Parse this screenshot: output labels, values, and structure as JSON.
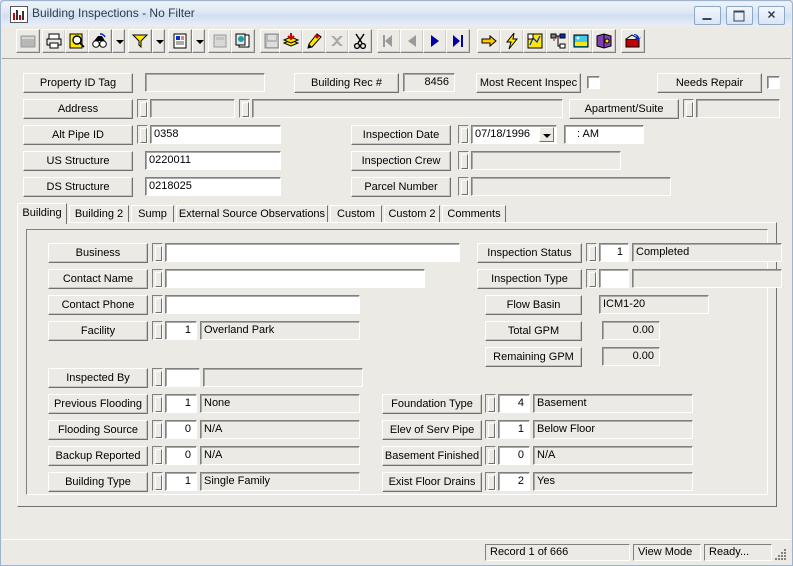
{
  "window": {
    "title": "Building Inspections - No Filter",
    "icon": "chart-bars-icon",
    "controls": {
      "minimize": "Minimize",
      "maximize": "Maximize",
      "close": "Close"
    }
  },
  "toolbar": {
    "buttons": [
      {
        "name": "grid-view-button",
        "icon": "grid-icon",
        "disabled": true
      },
      {
        "name": "print-button",
        "icon": "printer-icon",
        "disabled": false
      },
      {
        "name": "print-preview-button",
        "icon": "print-preview-icon",
        "disabled": false
      },
      {
        "name": "find-button",
        "icon": "binoculars-icon",
        "disabled": false
      },
      {
        "name": "find-dropdown-button",
        "icon": "chevron-down-icon",
        "disabled": false
      },
      {
        "name": "filter-button",
        "icon": "funnel-icon",
        "disabled": false
      },
      {
        "name": "filter-dropdown-button",
        "icon": "chevron-down-icon",
        "disabled": false
      },
      {
        "name": "report-button",
        "icon": "document-icon",
        "disabled": false
      },
      {
        "name": "report-dropdown-button",
        "icon": "chevron-down-icon",
        "disabled": false
      },
      {
        "name": "form-design-button",
        "icon": "form-icon",
        "disabled": true
      },
      {
        "name": "copy-record-button",
        "icon": "copy-pages-icon",
        "disabled": false
      },
      {
        "name": "save-button",
        "icon": "floppy-disk-icon",
        "disabled": true
      },
      {
        "name": "add-record-button",
        "icon": "add-stack-icon",
        "disabled": false
      },
      {
        "name": "edit-record-button",
        "icon": "pencil-icon",
        "disabled": false
      },
      {
        "name": "delete-record-button",
        "icon": "delete-x-icon",
        "disabled": true
      },
      {
        "name": "cut-button",
        "icon": "scissors-icon",
        "disabled": false
      },
      {
        "name": "first-record-button",
        "icon": "first-record-icon",
        "disabled": true
      },
      {
        "name": "previous-record-button",
        "icon": "previous-record-icon",
        "disabled": true
      },
      {
        "name": "next-record-button",
        "icon": "next-record-icon",
        "disabled": false
      },
      {
        "name": "last-record-button",
        "icon": "last-record-icon",
        "disabled": false
      },
      {
        "name": "goto-button",
        "icon": "yellow-arrow-icon",
        "disabled": false
      },
      {
        "name": "quick-action-button",
        "icon": "lightning-bolt-icon",
        "disabled": false
      },
      {
        "name": "map-button",
        "icon": "map-icon",
        "disabled": false
      },
      {
        "name": "hierarchy-button",
        "icon": "tree-nodes-icon",
        "disabled": false
      },
      {
        "name": "image-button",
        "icon": "picture-icon",
        "disabled": false
      },
      {
        "name": "help-book-button",
        "icon": "book-icon",
        "disabled": false
      },
      {
        "name": "exit-button",
        "icon": "exit-door-icon",
        "disabled": false
      }
    ]
  },
  "header": {
    "property_id_tag": {
      "label": "Property ID Tag",
      "value": ""
    },
    "building_rec": {
      "label": "Building Rec #",
      "value": "8456"
    },
    "most_recent_inspection": {
      "label": "Most Recent Inspec",
      "checked": false
    },
    "needs_repair": {
      "label": "Needs Repair",
      "checked": false
    },
    "address": {
      "label": "Address",
      "value1": "",
      "value2": ""
    },
    "apartment_suite": {
      "label": "Apartment/Suite",
      "value": ""
    },
    "alt_pipe_id": {
      "label": "Alt Pipe ID",
      "value": "0358"
    },
    "us_structure": {
      "label": "US Structure",
      "value": "0220011"
    },
    "ds_structure": {
      "label": "DS Structure",
      "value": "0218025"
    },
    "inspection_date": {
      "label": "Inspection Date",
      "value": "07/18/1996"
    },
    "inspection_time": {
      "value": ":   AM"
    },
    "inspection_crew": {
      "label": "Inspection Crew",
      "value": ""
    },
    "parcel_number": {
      "label": "Parcel Number",
      "value": ""
    }
  },
  "tabs": [
    {
      "label": "Building",
      "active": true
    },
    {
      "label": "Building 2",
      "active": false
    },
    {
      "label": "Sump",
      "active": false
    },
    {
      "label": "External Source Observations",
      "active": false
    },
    {
      "label": "Custom",
      "active": false
    },
    {
      "label": "Custom 2",
      "active": false
    },
    {
      "label": "Comments",
      "active": false
    }
  ],
  "building_tab": {
    "left_group": [
      {
        "label": "Business",
        "code": null,
        "desc": "",
        "desc_readonly": false
      },
      {
        "label": "Contact Name",
        "code": null,
        "desc": "",
        "desc_readonly": false
      },
      {
        "label": "Contact Phone",
        "code": null,
        "desc": "",
        "desc_readonly": false
      },
      {
        "label": "Facility",
        "code": "1",
        "desc": "Overland Park",
        "desc_readonly": true
      }
    ],
    "right_group": [
      {
        "label": "Inspection Status",
        "code": "1",
        "desc": "Completed"
      },
      {
        "label": "Inspection Type",
        "code": "",
        "desc": ""
      }
    ],
    "flow_basin": {
      "label": "Flow Basin",
      "value": "ICM1-20"
    },
    "total_gpm": {
      "label": "Total GPM",
      "value": "0.00"
    },
    "remaining_gpm": {
      "label": "Remaining GPM",
      "value": "0.00"
    },
    "lower_left": [
      {
        "label": "Inspected By",
        "code": "",
        "desc": "",
        "desc_readonly": true
      },
      {
        "label": "Previous Flooding",
        "code": "1",
        "desc": "None",
        "desc_readonly": true
      },
      {
        "label": "Flooding Source",
        "code": "0",
        "desc": "N/A",
        "desc_readonly": true
      },
      {
        "label": "Backup Reported",
        "code": "0",
        "desc": "N/A",
        "desc_readonly": true
      },
      {
        "label": "Building Type",
        "code": "1",
        "desc": "Single Family",
        "desc_readonly": true
      }
    ],
    "lower_right": [
      {
        "label": "Foundation Type",
        "code": "4",
        "desc": "Basement"
      },
      {
        "label": "Elev of Serv Pipe",
        "code": "1",
        "desc": "Below Floor"
      },
      {
        "label": "Basement Finished",
        "code": "0",
        "desc": "N/A"
      },
      {
        "label": "Exist Floor Drains",
        "code": "2",
        "desc": "Yes"
      }
    ]
  },
  "statusbar": {
    "record": "Record 1 of 666",
    "mode": "View Mode",
    "state": "Ready..."
  }
}
